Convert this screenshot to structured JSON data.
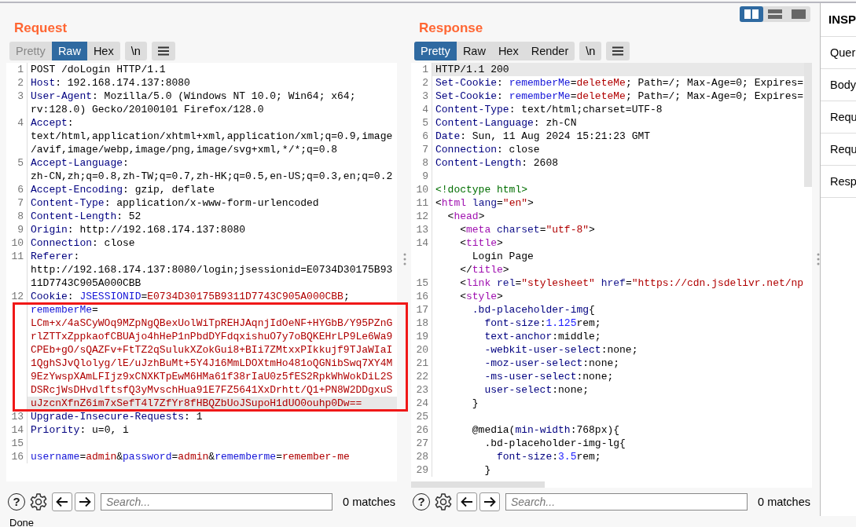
{
  "request": {
    "title": "Request",
    "tabs": [
      {
        "label": "Pretty",
        "selected": false,
        "disabled": true
      },
      {
        "label": "Raw",
        "selected": true,
        "disabled": false
      },
      {
        "label": "Hex",
        "selected": false,
        "disabled": false
      }
    ],
    "newline_toggle": "\\n",
    "lines": [
      {
        "number": "1",
        "current": false,
        "rows": [
          {
            "segments": [
              {
                "kind": "plain",
                "text": "POST /doLogin HTTP/1.1"
              }
            ]
          }
        ]
      },
      {
        "number": "2",
        "current": false,
        "rows": [
          {
            "segments": [
              {
                "kind": "key",
                "text": "Host"
              },
              {
                "kind": "plain",
                "text": ": 192.168.174.137:8080"
              }
            ]
          }
        ]
      },
      {
        "number": "3",
        "current": false,
        "rows": [
          {
            "segments": [
              {
                "kind": "key",
                "text": "User-Agent"
              },
              {
                "kind": "plain",
                "text": ": Mozilla/5.0 (Windows NT 10.0; Win64; x64;"
              }
            ]
          },
          {
            "segments": [
              {
                "kind": "plain",
                "text": "rv:128.0) Gecko/20100101 Firefox/128.0"
              }
            ]
          }
        ]
      },
      {
        "number": "4",
        "current": false,
        "rows": [
          {
            "segments": [
              {
                "kind": "key",
                "text": "Accept"
              },
              {
                "kind": "plain",
                "text": ":"
              }
            ]
          },
          {
            "segments": [
              {
                "kind": "plain",
                "text": "text/html,application/xhtml+xml,application/xml;q=0.9,image"
              }
            ]
          },
          {
            "segments": [
              {
                "kind": "plain",
                "text": "/avif,image/webp,image/png,image/svg+xml,*/*;q=0.8"
              }
            ]
          }
        ]
      },
      {
        "number": "5",
        "current": false,
        "rows": [
          {
            "segments": [
              {
                "kind": "key",
                "text": "Accept-Language"
              },
              {
                "kind": "plain",
                "text": ":"
              }
            ]
          },
          {
            "segments": [
              {
                "kind": "plain",
                "text": "zh-CN,zh;q=0.8,zh-TW;q=0.7,zh-HK;q=0.5,en-US;q=0.3,en;q=0.2"
              }
            ]
          }
        ]
      },
      {
        "number": "6",
        "current": false,
        "rows": [
          {
            "segments": [
              {
                "kind": "key",
                "text": "Accept-Encoding"
              },
              {
                "kind": "plain",
                "text": ": gzip, deflate"
              }
            ]
          }
        ]
      },
      {
        "number": "7",
        "current": false,
        "rows": [
          {
            "segments": [
              {
                "kind": "key",
                "text": "Content-Type"
              },
              {
                "kind": "plain",
                "text": ": application/x-www-form-urlencoded"
              }
            ]
          }
        ]
      },
      {
        "number": "8",
        "current": false,
        "rows": [
          {
            "segments": [
              {
                "kind": "key",
                "text": "Content-Length"
              },
              {
                "kind": "plain",
                "text": ": 52"
              }
            ]
          }
        ]
      },
      {
        "number": "9",
        "current": false,
        "rows": [
          {
            "segments": [
              {
                "kind": "key",
                "text": "Origin"
              },
              {
                "kind": "plain",
                "text": ": http://192.168.174.137:8080"
              }
            ]
          }
        ]
      },
      {
        "number": "10",
        "current": false,
        "rows": [
          {
            "segments": [
              {
                "kind": "key",
                "text": "Connection"
              },
              {
                "kind": "plain",
                "text": ": close"
              }
            ]
          }
        ]
      },
      {
        "number": "11",
        "current": false,
        "rows": [
          {
            "segments": [
              {
                "kind": "key",
                "text": "Referer"
              },
              {
                "kind": "plain",
                "text": ":"
              }
            ]
          },
          {
            "segments": [
              {
                "kind": "plain",
                "text": "http://192.168.174.137:8080/login;jsessionid=E0734D30175B93"
              }
            ]
          },
          {
            "segments": [
              {
                "kind": "plain",
                "text": "11D7743C905A000CBB"
              }
            ]
          }
        ]
      },
      {
        "number": "12",
        "current": true,
        "rows": [
          {
            "segments": [
              {
                "kind": "key",
                "text": "Cookie"
              },
              {
                "kind": "plain",
                "text": ": "
              },
              {
                "kind": "name",
                "text": "JSESSIONID"
              },
              {
                "kind": "plain",
                "text": "="
              },
              {
                "kind": "value",
                "text": "E0734D30175B9311D7743C905A000CBB"
              },
              {
                "kind": "plain",
                "text": ";"
              }
            ]
          },
          {
            "segments": [
              {
                "kind": "name",
                "text": "rememberMe"
              },
              {
                "kind": "plain",
                "text": "="
              }
            ]
          },
          {
            "segments": [
              {
                "kind": "value",
                "text": "LCm+x/4aSCyWOq9MZpNgQBexUolWiTpREHJAqnjIdOeNF+HYGbB/Y95PZnG"
              }
            ]
          },
          {
            "segments": [
              {
                "kind": "value",
                "text": "rlZTTxZppkaofCBUAjo4hHeP1nPbdDYFdqxishuO7y7oBQKEHrLP9Le6Wa9"
              }
            ]
          },
          {
            "segments": [
              {
                "kind": "value",
                "text": "CPEb+gO/sQAZFv+FtTZ2qSulukXZokGui8+BIi7ZMtxxPIkkujf9TJaWIaI"
              }
            ]
          },
          {
            "segments": [
              {
                "kind": "value",
                "text": "1QghSJvQlolyg/lE/uJzhBuMt+5Y4J16MmLDOXtmHo481oQGNibSwq7XY4M"
              }
            ]
          },
          {
            "segments": [
              {
                "kind": "value",
                "text": "9EzYwspXAmLFIjz9xCNXKTpEwM6HMa61f38rIaU0z5fES2RpkWhWokDiL2S"
              }
            ]
          },
          {
            "segments": [
              {
                "kind": "value",
                "text": "DSRcjWsDHvdlftsfQ3yMvschHua91E7FZ5641XxDrhtt/Q1+PN8W2DDgxuS"
              }
            ]
          },
          {
            "segments": [
              {
                "kind": "value",
                "text": "uJzcnXfnZ6im7xSefT4l7ZfYr8fHBQZbUoJSupoH1dUO0ouhp0Dw=="
              }
            ]
          }
        ]
      },
      {
        "number": "13",
        "current": false,
        "rows": [
          {
            "segments": [
              {
                "kind": "key",
                "text": "Upgrade-Insecure-Requests"
              },
              {
                "kind": "plain",
                "text": ": 1"
              }
            ]
          }
        ]
      },
      {
        "number": "14",
        "current": false,
        "rows": [
          {
            "segments": [
              {
                "kind": "key",
                "text": "Priority"
              },
              {
                "kind": "plain",
                "text": ": u=0, i"
              }
            ]
          }
        ]
      },
      {
        "number": "15",
        "current": false
      },
      {
        "number": "16",
        "current": false,
        "rows": [
          {
            "segments": [
              {
                "kind": "name",
                "text": "username"
              },
              {
                "kind": "plain",
                "text": "="
              },
              {
                "kind": "value",
                "text": "admin"
              },
              {
                "kind": "plain",
                "text": "&"
              },
              {
                "kind": "name",
                "text": "password"
              },
              {
                "kind": "plain",
                "text": "="
              },
              {
                "kind": "value",
                "text": "admin"
              },
              {
                "kind": "plain",
                "text": "&"
              },
              {
                "kind": "name",
                "text": "rememberme"
              },
              {
                "kind": "plain",
                "text": "="
              },
              {
                "kind": "value",
                "text": "remember-me"
              }
            ]
          }
        ]
      }
    ],
    "search": {
      "help": "?",
      "placeholder": "Search...",
      "matches": "0 matches"
    }
  },
  "response": {
    "title": "Response",
    "view_buttons": [
      {
        "kind": "columns",
        "selected": true
      },
      {
        "kind": "rows",
        "selected": false
      },
      {
        "kind": "single",
        "selected": false
      }
    ],
    "tabs": [
      {
        "label": "Pretty",
        "selected": true,
        "disabled": false
      },
      {
        "label": "Raw",
        "selected": false,
        "disabled": false
      },
      {
        "label": "Hex",
        "selected": false,
        "disabled": false
      },
      {
        "label": "Render",
        "selected": false,
        "disabled": false
      }
    ],
    "newline_toggle": "\\n",
    "lines": [
      {
        "number": "1",
        "current": true,
        "rows": [
          {
            "segments": [
              {
                "kind": "plain",
                "text": "HTTP/1.1 200"
              }
            ]
          }
        ]
      },
      {
        "number": "2",
        "current": false,
        "rows": [
          {
            "segments": [
              {
                "kind": "key",
                "text": "Set-Cookie"
              },
              {
                "kind": "plain",
                "text": ": "
              },
              {
                "kind": "name",
                "text": "rememberMe"
              },
              {
                "kind": "plain",
                "text": "="
              },
              {
                "kind": "value",
                "text": "deleteMe"
              },
              {
                "kind": "plain",
                "text": "; Path=/; Max-Age=0; Expires="
              }
            ]
          }
        ]
      },
      {
        "number": "3",
        "current": false,
        "rows": [
          {
            "segments": [
              {
                "kind": "key",
                "text": "Set-Cookie"
              },
              {
                "kind": "plain",
                "text": ": "
              },
              {
                "kind": "name",
                "text": "rememberMe"
              },
              {
                "kind": "plain",
                "text": "="
              },
              {
                "kind": "value",
                "text": "deleteMe"
              },
              {
                "kind": "plain",
                "text": "; Path=/; Max-Age=0; Expires="
              }
            ]
          }
        ]
      },
      {
        "number": "4",
        "current": false,
        "rows": [
          {
            "segments": [
              {
                "kind": "key",
                "text": "Content-Type"
              },
              {
                "kind": "plain",
                "text": ": text/html;charset=UTF-8"
              }
            ]
          }
        ]
      },
      {
        "number": "5",
        "current": false,
        "rows": [
          {
            "segments": [
              {
                "kind": "key",
                "text": "Content-Language"
              },
              {
                "kind": "plain",
                "text": ": zh-CN"
              }
            ]
          }
        ]
      },
      {
        "number": "6",
        "current": false,
        "rows": [
          {
            "segments": [
              {
                "kind": "key",
                "text": "Date"
              },
              {
                "kind": "plain",
                "text": ": Sun, 11 Aug 2024 15:21:23 GMT"
              }
            ]
          }
        ]
      },
      {
        "number": "7",
        "current": false,
        "rows": [
          {
            "segments": [
              {
                "kind": "key",
                "text": "Connection"
              },
              {
                "kind": "plain",
                "text": ": close"
              }
            ]
          }
        ]
      },
      {
        "number": "8",
        "current": false,
        "rows": [
          {
            "segments": [
              {
                "kind": "key",
                "text": "Content-Length"
              },
              {
                "kind": "plain",
                "text": ": 2608"
              }
            ]
          }
        ]
      },
      {
        "number": "9",
        "current": false
      },
      {
        "number": "10",
        "current": false,
        "rows": [
          {
            "segments": [
              {
                "kind": "doctype",
                "text": "<!doctype html>"
              }
            ]
          }
        ]
      },
      {
        "number": "11",
        "current": false,
        "rows": [
          {
            "segments": [
              {
                "kind": "plain",
                "text": "<"
              },
              {
                "kind": "tag",
                "text": "html"
              },
              {
                "kind": "attr",
                "text": " lang"
              },
              {
                "kind": "plain",
                "text": "="
              },
              {
                "kind": "string",
                "text": "\"en\""
              },
              {
                "kind": "plain",
                "text": ">"
              }
            ]
          }
        ]
      },
      {
        "number": "12",
        "current": false,
        "rows": [
          {
            "segments": [
              {
                "kind": "plain",
                "text": "  <"
              },
              {
                "kind": "tag",
                "text": "head"
              },
              {
                "kind": "plain",
                "text": ">"
              }
            ]
          }
        ]
      },
      {
        "number": "13",
        "current": false,
        "rows": [
          {
            "segments": [
              {
                "kind": "plain",
                "text": "    <"
              },
              {
                "kind": "tag",
                "text": "meta"
              },
              {
                "kind": "attr",
                "text": " charset"
              },
              {
                "kind": "plain",
                "text": "="
              },
              {
                "kind": "string",
                "text": "\"utf-8\""
              },
              {
                "kind": "plain",
                "text": ">"
              }
            ]
          }
        ]
      },
      {
        "number": "14",
        "current": false,
        "rows": [
          {
            "segments": [
              {
                "kind": "plain",
                "text": "    <"
              },
              {
                "kind": "tag",
                "text": "title"
              },
              {
                "kind": "plain",
                "text": ">"
              }
            ]
          },
          {
            "segments": [
              {
                "kind": "plain",
                "text": "      Login Page"
              }
            ]
          },
          {
            "segments": [
              {
                "kind": "plain",
                "text": "    </"
              },
              {
                "kind": "tag",
                "text": "title"
              },
              {
                "kind": "plain",
                "text": ">"
              }
            ]
          }
        ]
      },
      {
        "number": "15",
        "current": false,
        "rows": [
          {
            "segments": [
              {
                "kind": "plain",
                "text": "    <"
              },
              {
                "kind": "tag",
                "text": "link"
              },
              {
                "kind": "attr",
                "text": " rel"
              },
              {
                "kind": "plain",
                "text": "="
              },
              {
                "kind": "string",
                "text": "\"stylesheet\""
              },
              {
                "kind": "attr",
                "text": " href"
              },
              {
                "kind": "plain",
                "text": "="
              },
              {
                "kind": "string",
                "text": "\"https://cdn.jsdelivr.net/np"
              }
            ]
          }
        ]
      },
      {
        "number": "16",
        "current": false,
        "rows": [
          {
            "segments": [
              {
                "kind": "plain",
                "text": "    <"
              },
              {
                "kind": "tag",
                "text": "style"
              },
              {
                "kind": "plain",
                "text": ">"
              }
            ]
          }
        ]
      },
      {
        "number": "17",
        "current": false,
        "rows": [
          {
            "segments": [
              {
                "kind": "key",
                "text": "      .bd-placeholder-img"
              },
              {
                "kind": "plain",
                "text": "{"
              }
            ]
          }
        ]
      },
      {
        "number": "18",
        "current": false,
        "rows": [
          {
            "segments": [
              {
                "kind": "key",
                "text": "        font-size"
              },
              {
                "kind": "plain",
                "text": ":"
              },
              {
                "kind": "number",
                "text": "1.125"
              },
              {
                "kind": "plain",
                "text": "rem;"
              }
            ]
          }
        ]
      },
      {
        "number": "19",
        "current": false,
        "rows": [
          {
            "segments": [
              {
                "kind": "key",
                "text": "        text-anchor"
              },
              {
                "kind": "plain",
                "text": ":middle;"
              }
            ]
          }
        ]
      },
      {
        "number": "20",
        "current": false,
        "rows": [
          {
            "segments": [
              {
                "kind": "key",
                "text": "        -webkit-user-select"
              },
              {
                "kind": "plain",
                "text": ":none;"
              }
            ]
          }
        ]
      },
      {
        "number": "21",
        "current": false,
        "rows": [
          {
            "segments": [
              {
                "kind": "key",
                "text": "        -moz-user-select"
              },
              {
                "kind": "plain",
                "text": ":none;"
              }
            ]
          }
        ]
      },
      {
        "number": "22",
        "current": false,
        "rows": [
          {
            "segments": [
              {
                "kind": "key",
                "text": "        -ms-user-select"
              },
              {
                "kind": "plain",
                "text": ":none;"
              }
            ]
          }
        ]
      },
      {
        "number": "23",
        "current": false,
        "rows": [
          {
            "segments": [
              {
                "kind": "key",
                "text": "        user-select"
              },
              {
                "kind": "plain",
                "text": ":none;"
              }
            ]
          }
        ]
      },
      {
        "number": "24",
        "current": false,
        "rows": [
          {
            "segments": [
              {
                "kind": "plain",
                "text": "      }"
              }
            ]
          }
        ]
      },
      {
        "number": "25",
        "current": false
      },
      {
        "number": "26",
        "current": false,
        "rows": [
          {
            "segments": [
              {
                "kind": "plain",
                "text": "      @media("
              },
              {
                "kind": "key",
                "text": "min-width"
              },
              {
                "kind": "plain",
                "text": ":768px){"
              }
            ]
          }
        ]
      },
      {
        "number": "27",
        "current": false,
        "rows": [
          {
            "segments": [
              {
                "kind": "plain",
                "text": "        .bd-placeholder-img-lg{"
              }
            ]
          }
        ]
      },
      {
        "number": "28",
        "current": false,
        "rows": [
          {
            "segments": [
              {
                "kind": "key",
                "text": "          font-size"
              },
              {
                "kind": "plain",
                "text": ":"
              },
              {
                "kind": "number",
                "text": "3.5"
              },
              {
                "kind": "plain",
                "text": "rem;"
              }
            ]
          }
        ]
      },
      {
        "number": "29",
        "current": false,
        "rows": [
          {
            "segments": [
              {
                "kind": "plain",
                "text": "        }"
              }
            ]
          }
        ]
      }
    ],
    "search": {
      "help": "?",
      "placeholder": "Search...",
      "matches": "0 matches"
    }
  },
  "inspector": {
    "title": "INSP",
    "items": [
      "Quer",
      "Body",
      "Requ",
      "Requ",
      "Resp"
    ]
  },
  "status_bar": "Done"
}
